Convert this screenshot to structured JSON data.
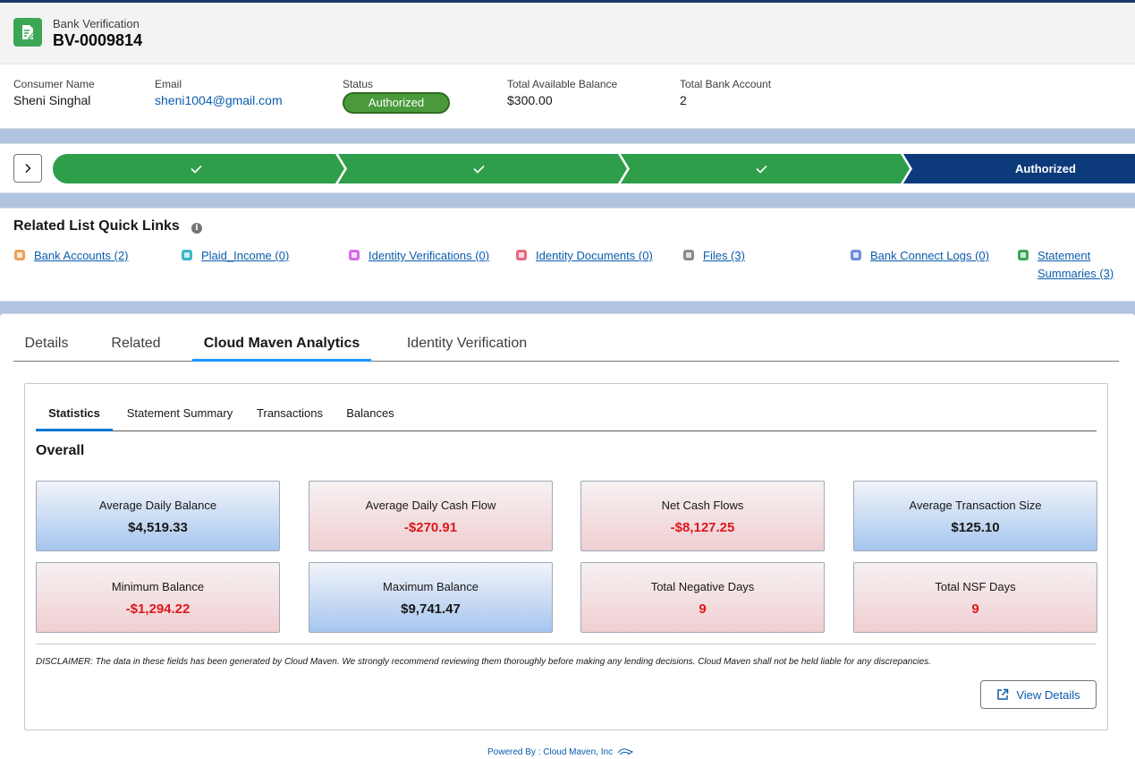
{
  "record": {
    "type": "Bank Verification",
    "name": "BV-0009814"
  },
  "fields": {
    "consumer_name": {
      "label": "Consumer Name",
      "value": "Sheni Singhal"
    },
    "email": {
      "label": "Email",
      "value": "sheni1004@gmail.com"
    },
    "status": {
      "label": "Status",
      "value": "Authorized"
    },
    "balance": {
      "label": "Total Available Balance",
      "value": "$300.00"
    },
    "accounts": {
      "label": "Total Bank Account",
      "value": "2"
    }
  },
  "path": {
    "current_stage": "Authorized",
    "completed_stages": 3
  },
  "quick_links": {
    "title": "Related List Quick Links",
    "items": [
      {
        "label": "Bank Accounts (2)",
        "color": "#e9a25c"
      },
      {
        "label": "Plaid_Income (0)",
        "color": "#3ab7c4"
      },
      {
        "label": "Identity Verifications (0)",
        "color": "#d56be3"
      },
      {
        "label": "Identity Documents (0)",
        "color": "#e66a7f"
      },
      {
        "label": "Files (3)",
        "color": "#8a8a8a"
      },
      {
        "label": "Bank Connect Logs (0)",
        "color": "#6b8ee0"
      },
      {
        "label": "Statement",
        "label2": "Summaries (3)",
        "color": "#3ba755"
      }
    ]
  },
  "tabs": [
    "Details",
    "Related",
    "Cloud Maven Analytics",
    "Identity Verification"
  ],
  "subtabs": [
    "Statistics",
    "Statement Summary",
    "Transactions",
    "Balances"
  ],
  "section_title": "Overall",
  "stats": [
    {
      "label": "Average Daily Balance",
      "value": "$4,519.33",
      "tone": "blue"
    },
    {
      "label": "Average Daily Cash Flow",
      "value": "-$270.91",
      "tone": "red"
    },
    {
      "label": "Net Cash Flows",
      "value": "-$8,127.25",
      "tone": "red"
    },
    {
      "label": "Average Transaction Size",
      "value": "$125.10",
      "tone": "blue"
    },
    {
      "label": "Minimum Balance",
      "value": "-$1,294.22",
      "tone": "red"
    },
    {
      "label": "Maximum Balance",
      "value": "$9,741.47",
      "tone": "blue"
    },
    {
      "label": "Total Negative Days",
      "value": "9",
      "tone": "red"
    },
    {
      "label": "Total NSF Days",
      "value": "9",
      "tone": "red"
    }
  ],
  "disclaimer": "DISCLAIMER: The data in these fields has been generated by Cloud Maven. We strongly recommend reviewing them thoroughly before making any lending decisions. Cloud Maven shall not be held liable for any discrepancies.",
  "view_details_label": "View Details",
  "powered_by": "Powered By : Cloud Maven, Inc"
}
